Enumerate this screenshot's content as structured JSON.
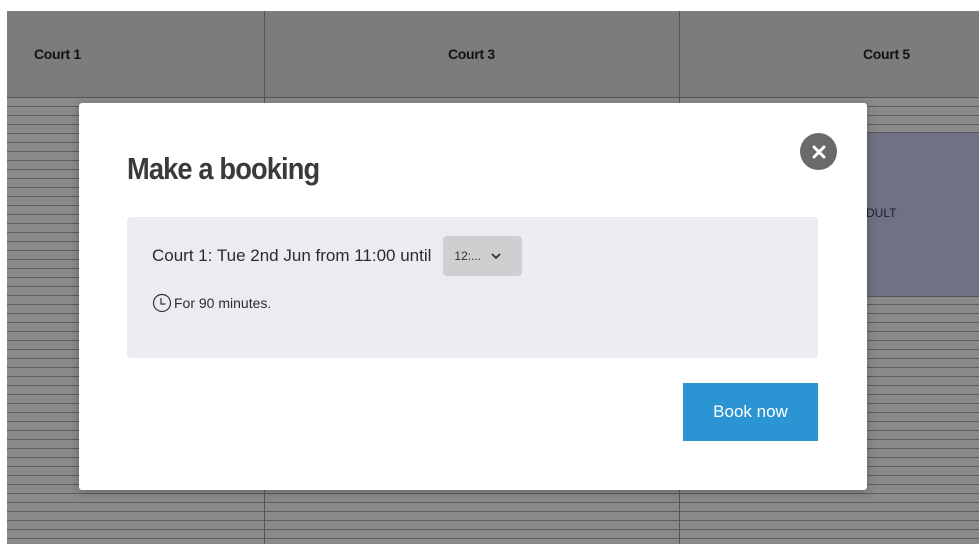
{
  "schedule": {
    "courts": [
      "Court 1",
      "Court 3",
      "Court 5"
    ],
    "booked_label": "ADULT"
  },
  "modal": {
    "title": "Make a booking",
    "booking_text": "Court 1: Tue 2nd Jun from 11:00 until",
    "end_time_value": "12:...",
    "duration_text": "For 90 minutes.",
    "book_button_label": "Book now"
  },
  "icons": {
    "close": "close-icon",
    "clock": "clock-icon",
    "dropdown": "chevron-down-icon"
  },
  "colors": {
    "accent": "#2b95d3",
    "overlay": "#7c7c7c",
    "info_box": "#ebecef",
    "close_button": "#6a6a6a"
  }
}
